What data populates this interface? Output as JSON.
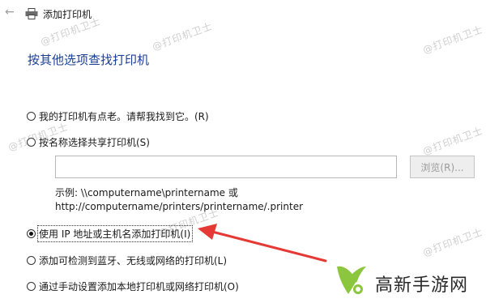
{
  "window": {
    "title": "添加打印机"
  },
  "page": {
    "heading": "按其他选项查找打印机"
  },
  "options": [
    {
      "label": "我的打印机有点老。请帮我找到它。(R)",
      "selected": false
    },
    {
      "label": "按名称选择共享打印机(S)",
      "selected": false
    },
    {
      "label": "使用 IP 地址或主机名添加打印机(I)",
      "selected": true
    },
    {
      "label": "添加可检测到蓝牙、无线或网络的打印机(L)",
      "selected": false
    },
    {
      "label": "通过手动设置添加本地打印机或网络打印机(O)",
      "selected": false
    }
  ],
  "share": {
    "input_value": "",
    "browse_label": "浏览(R)...",
    "example_line1": "示例: \\\\computername\\printername 或",
    "example_line2": "http://computername/printers/printername/.printer"
  },
  "watermarks": [
    "@打印机卫士",
    "@打印机卫士",
    "@打印机卫士",
    "@打印机卫士",
    "@打印机卫士",
    "@打印机卫士",
    "@打印机卫士"
  ],
  "brand": {
    "name": "高新手游网",
    "green": "#8cc63f"
  },
  "colors": {
    "heading": "#1c3f94",
    "arrow": "#e53935"
  }
}
